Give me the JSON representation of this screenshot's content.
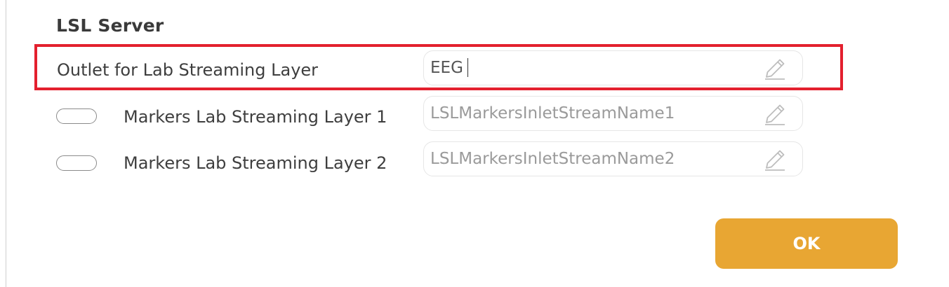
{
  "section": {
    "title": "LSL Server"
  },
  "outlet": {
    "label": "Outlet for Lab Streaming Layer",
    "value": "EEG"
  },
  "markers": [
    {
      "label": "Markers Lab Streaming Layer 1",
      "placeholder": "LSLMarkersInletStreamName1",
      "enabled": false
    },
    {
      "label": "Markers Lab Streaming Layer 2",
      "placeholder": "LSLMarkersInletStreamName2",
      "enabled": false
    }
  ],
  "actions": {
    "ok_label": "OK"
  },
  "colors": {
    "highlight": "#e3202e",
    "ok_button": "#e8a633",
    "text": "#3e3e3e",
    "placeholder": "#9a9a9a"
  },
  "icons": {
    "edit": "pencil-icon"
  }
}
